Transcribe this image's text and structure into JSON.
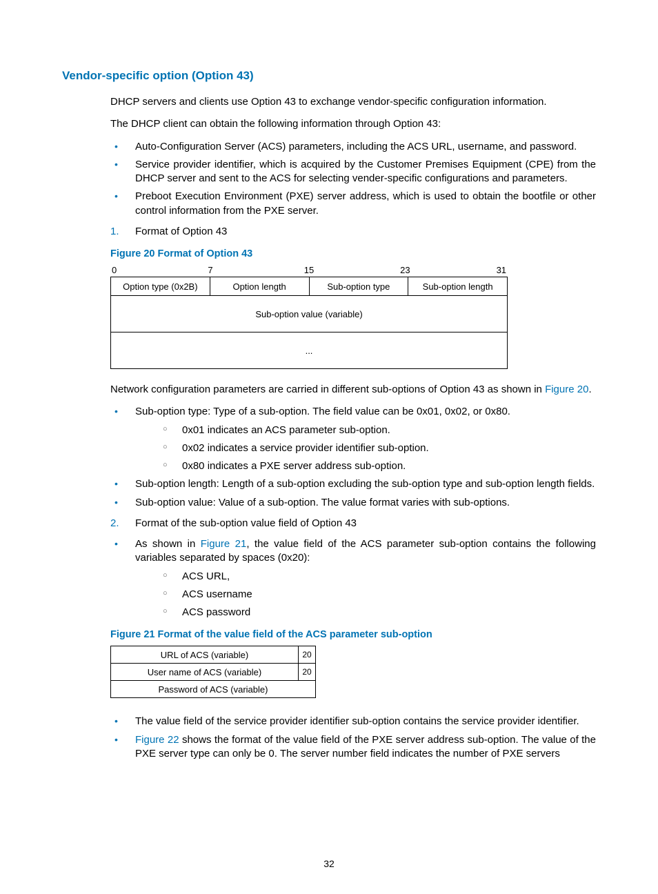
{
  "heading": "Vendor-specific option (Option 43)",
  "p1": "DHCP servers and clients use Option 43 to exchange vendor-specific configuration information.",
  "p2": "The DHCP client can obtain the following information through Option 43:",
  "blist1": {
    "i1": "Auto-Configuration Server (ACS) parameters, including the ACS URL, username, and password.",
    "i2": "Service provider identifier, which is acquired by the Customer Premises Equipment (CPE) from the DHCP server and sent to the ACS for selecting vender-specific configurations and parameters.",
    "i3": "Preboot Execution Environment (PXE) server address, which is used to obtain the bootfile or other control information from the PXE server."
  },
  "num1": {
    "n": "1.",
    "t": "Format of Option 43"
  },
  "fig20": {
    "caption": "Figure 20 Format of Option 43",
    "scale": {
      "a": "0",
      "b": "7",
      "c": "15",
      "d": "23",
      "e": "31"
    },
    "cells": {
      "c1": "Option type (0x2B)",
      "c2": "Option length",
      "c3": "Sub-option type",
      "c4": "Sub-option length"
    },
    "r2": "Sub-option value (variable)",
    "r3": "..."
  },
  "p3a": "Network configuration parameters are carried in different sub-options of Option 43 as shown in ",
  "p3link": "Figure 20",
  "p3b": ".",
  "blist2": {
    "i1": "Sub-option type: Type of a sub-option. The field value can be 0x01, 0x02, or 0x80.",
    "sub": {
      "s1": "0x01 indicates an ACS parameter sub-option.",
      "s2": "0x02 indicates a service provider identifier sub-option.",
      "s3": "0x80 indicates a PXE server address sub-option."
    },
    "i2": "Sub-option length: Length of a sub-option excluding the sub-option type and sub-option length fields.",
    "i3": "Sub-option value: Value of a sub-option. The value format varies with sub-options."
  },
  "num2": {
    "n": "2.",
    "t": "Format of the sub-option value field of Option 43"
  },
  "blist3": {
    "i1a": "As shown in ",
    "i1link": "Figure 21",
    "i1b": ", the value field of the ACS parameter sub-option contains the following variables separated by spaces (0x20):",
    "sub": {
      "s1": "ACS URL,",
      "s2": "ACS username",
      "s3": "ACS password"
    }
  },
  "fig21": {
    "caption": "Figure 21 Format of the value field of the ACS parameter sub-option",
    "r1": {
      "label": "URL of ACS (variable)",
      "sep": "20"
    },
    "r2": {
      "label": "User name of ACS (variable)",
      "sep": "20"
    },
    "r3": {
      "label": "Password of ACS (variable)"
    }
  },
  "blist4": {
    "i1": "The value field of the service provider identifier sub-option contains the service provider identifier.",
    "i2link": "Figure 22",
    "i2": " shows the format of the value field of the PXE server address sub-option. The value of the PXE server type can only be 0. The server number field indicates the number of PXE servers"
  },
  "pageNum": "32"
}
